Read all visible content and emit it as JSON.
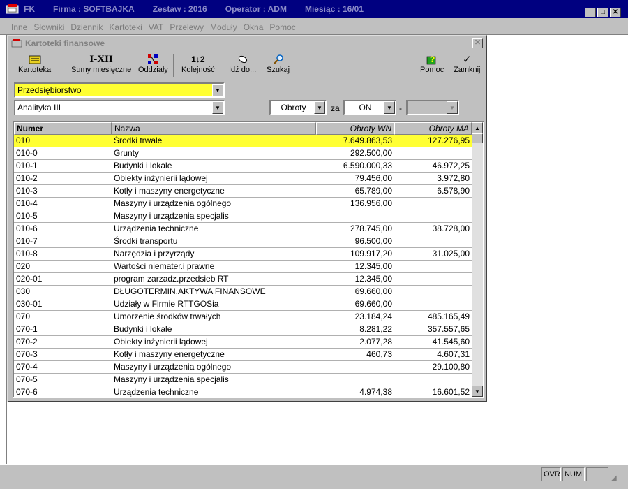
{
  "app": {
    "name": "FK",
    "firma": "Firma : SOFTBAJKA",
    "zestaw": "Zestaw : 2016",
    "operator": "Operator : ADM",
    "miesiac": "Miesiąc : 16/01"
  },
  "menu": [
    "Inne",
    "Słowniki",
    "Dziennik",
    "Kartoteki",
    "VAT",
    "Przelewy",
    "Moduły",
    "Okna",
    "Pomoc"
  ],
  "window": {
    "title": "Kartoteki finansowe",
    "close_glyph": "✕"
  },
  "toolbar": {
    "kartoteka": "Kartoteka",
    "sumy_icon_text": "I-XII",
    "sumy": "Sumy miesięczne",
    "oddzialy": "Oddziały",
    "kolejnosc": "Kolejność",
    "idz_do": "Idź do...",
    "szukaj": "Szukaj",
    "pomoc": "Pomoc",
    "zamknij": "Zamknij"
  },
  "filters": {
    "company": "Przedsiębiorstwo",
    "analytics": "Analityka III",
    "mode": "Obroty",
    "za_label": "za",
    "period": "ON",
    "dash": "-",
    "period_to": ""
  },
  "colors": {
    "selected_row": "#ffff33",
    "title_bar": "#000080"
  },
  "grid": {
    "columns": [
      "Numer",
      "Nazwa",
      "Obroty WN",
      "Obroty MA"
    ],
    "rows": [
      [
        "010",
        "Środki trwałe",
        "7.649.863,53",
        "127.276,95"
      ],
      [
        "010-0",
        "Grunty",
        "292.500,00",
        ""
      ],
      [
        "010-1",
        "Budynki i lokale",
        "6.590.000,33",
        "46.972,25"
      ],
      [
        "010-2",
        "Obiekty inżynierii lądowej",
        "79.456,00",
        "3.972,80"
      ],
      [
        "010-3",
        "Kotły i maszyny energetyczne",
        "65.789,00",
        "6.578,90"
      ],
      [
        "010-4",
        "Maszyny i urządzenia ogólnego",
        "136.956,00",
        ""
      ],
      [
        "010-5",
        "Maszyny i urządzenia specjalis",
        "",
        ""
      ],
      [
        "010-6",
        "Urządzenia techniczne",
        "278.745,00",
        "38.728,00"
      ],
      [
        "010-7",
        "Środki transportu",
        "96.500,00",
        ""
      ],
      [
        "010-8",
        "Narzędzia i przyrządy",
        "109.917,20",
        "31.025,00"
      ],
      [
        "020",
        "Wartości niemater.i prawne",
        "12.345,00",
        ""
      ],
      [
        "020-01",
        "program zarzadz.przedsieb RT",
        "12.345,00",
        ""
      ],
      [
        "030",
        "DŁUGOTERMIN.AKTYWA FINANSOWE",
        "69.660,00",
        ""
      ],
      [
        "030-01",
        "Udziały  w Firmie RTTGOSia",
        "69.660,00",
        ""
      ],
      [
        "070",
        "Umorzenie środków trwałych",
        "23.184,24",
        "485.165,49"
      ],
      [
        "070-1",
        "Budynki i lokale",
        "8.281,22",
        "357.557,65"
      ],
      [
        "070-2",
        "Obiekty inżynierii lądowej",
        "2.077,28",
        "41.545,60"
      ],
      [
        "070-3",
        "Kotły i maszyny energetyczne",
        "460,73",
        "4.607,31"
      ],
      [
        "070-4",
        "Maszyny i urządzenia ogólnego",
        "",
        "29.100,80"
      ],
      [
        "070-5",
        "Maszyny i urządzenia specjalis",
        "",
        ""
      ],
      [
        "070-6",
        "Urządzenia techniczne",
        "4.974,38",
        "16.601,52"
      ]
    ]
  },
  "status": {
    "ovr": "OVR",
    "num": "NUM"
  }
}
